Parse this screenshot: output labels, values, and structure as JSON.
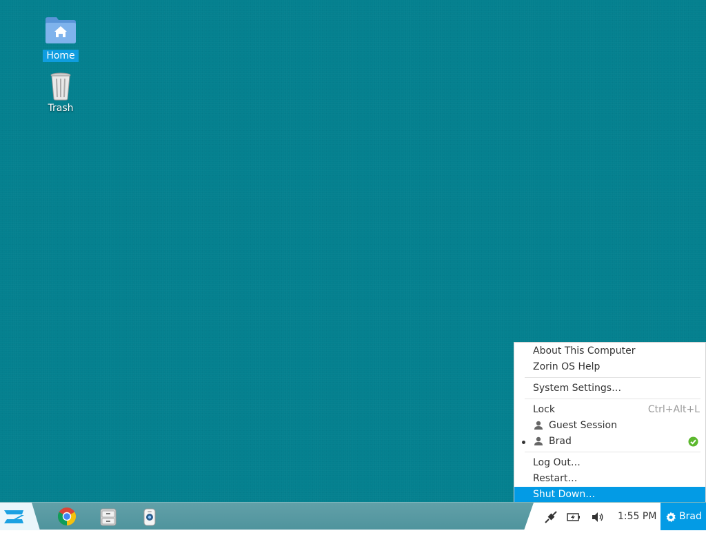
{
  "desktop": {
    "icons": [
      {
        "label": "Home",
        "icon": "home-folder-icon"
      },
      {
        "label": "Trash",
        "icon": "trash-icon"
      }
    ]
  },
  "taskbar": {
    "start_icon": "zorin-logo-icon",
    "launchers": [
      {
        "icon": "chrome-icon"
      },
      {
        "icon": "file-manager-icon"
      },
      {
        "icon": "software-store-icon"
      }
    ],
    "tray": {
      "icons": [
        "network-icon",
        "battery-icon",
        "volume-icon"
      ],
      "clock": "1:55 PM",
      "user_name": "Brad"
    }
  },
  "menu": {
    "about": "About This Computer",
    "help": "Zorin OS Help",
    "system_settings": "System Settings…",
    "lock": "Lock",
    "lock_shortcut": "Ctrl+Alt+L",
    "guest_session": "Guest Session",
    "current_user": "Brad",
    "log_out": "Log Out…",
    "restart": "Restart…",
    "shut_down": "Shut Down…"
  },
  "colors": {
    "desktop_bg": "#04808f",
    "accent": "#039be5",
    "panel": "#559aa2"
  }
}
